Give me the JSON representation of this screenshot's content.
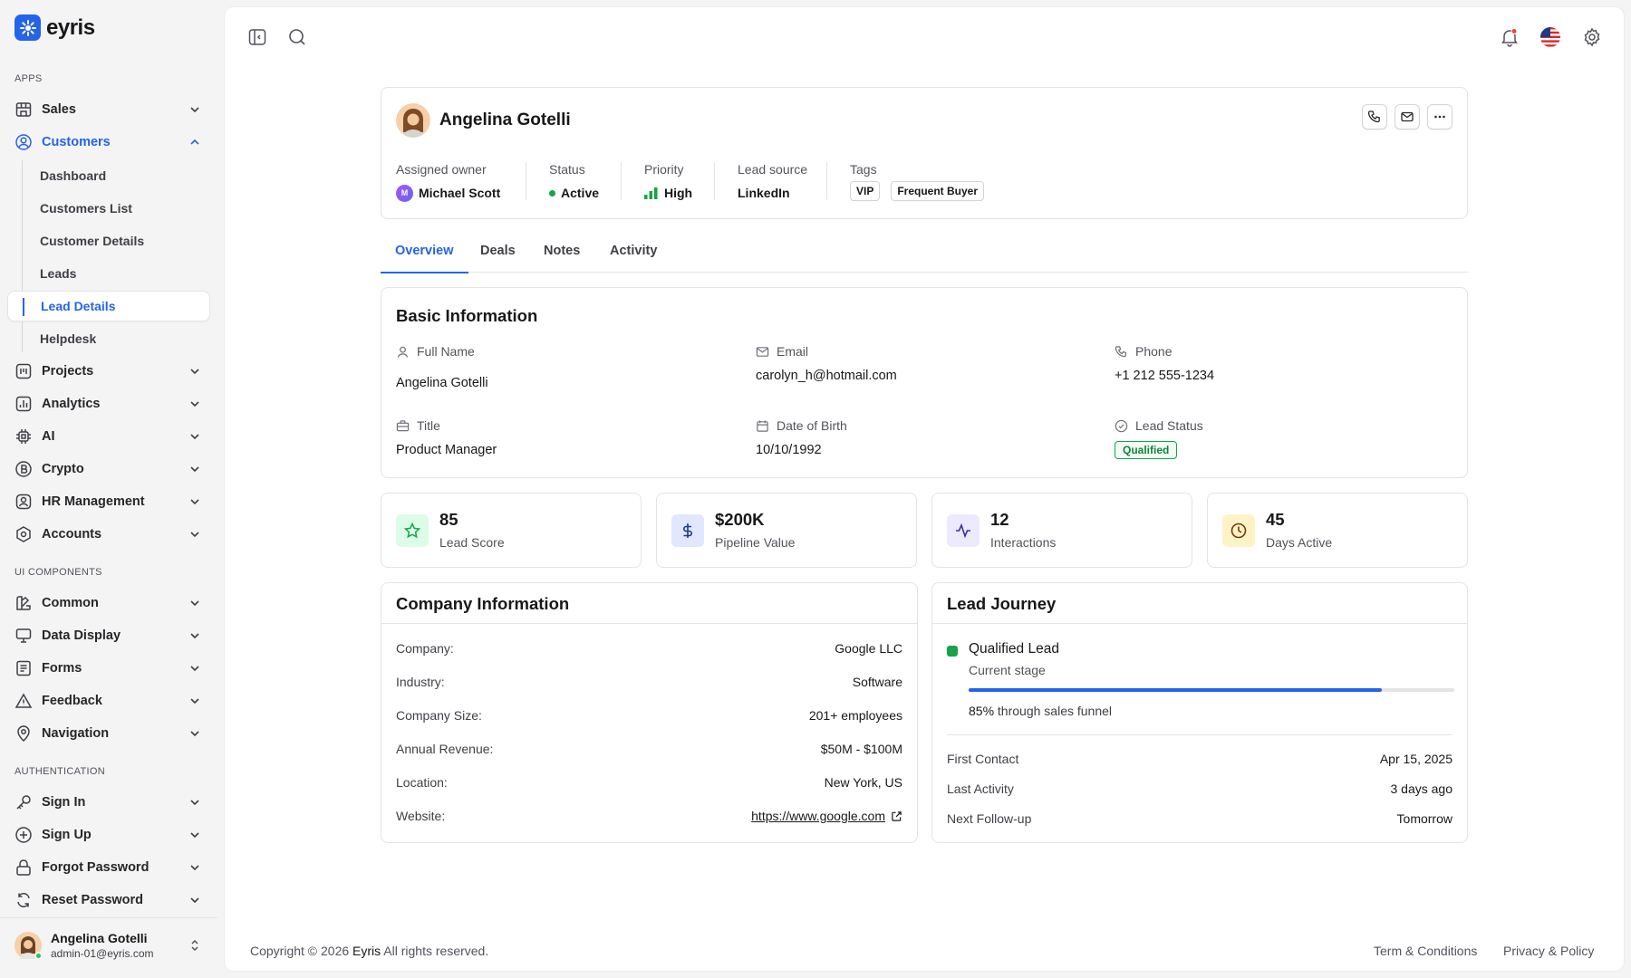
{
  "app": {
    "name": "eyris"
  },
  "sidebar": {
    "sections": {
      "apps": "APPS",
      "ui": "UI COMPONENTS",
      "auth": "AUTHENTICATION"
    },
    "apps": [
      {
        "label": "Sales"
      },
      {
        "label": "Customers"
      }
    ],
    "customers_sub": [
      "Dashboard",
      "Customers List",
      "Customer Details",
      "Leads",
      "Lead Details",
      "Helpdesk"
    ],
    "apps2": [
      {
        "label": "Projects"
      },
      {
        "label": "Analytics"
      },
      {
        "label": "AI"
      },
      {
        "label": "Crypto"
      },
      {
        "label": "HR Management"
      },
      {
        "label": "Accounts"
      }
    ],
    "ui": [
      {
        "label": "Common"
      },
      {
        "label": "Data Display"
      },
      {
        "label": "Forms"
      },
      {
        "label": "Feedback"
      },
      {
        "label": "Navigation"
      }
    ],
    "auth": [
      {
        "label": "Sign In"
      },
      {
        "label": "Sign Up"
      },
      {
        "label": "Forgot Password"
      },
      {
        "label": "Reset Password"
      }
    ],
    "user": {
      "name": "Angelina Gotelli",
      "email": "admin-01@eyris.com"
    }
  },
  "profile": {
    "name": "Angelina Gotelli",
    "meta": {
      "owner_label": "Assigned owner",
      "owner": "Michael Scott",
      "owner_initial": "M",
      "status_label": "Status",
      "status": "Active",
      "priority_label": "Priority",
      "priority": "High",
      "source_label": "Lead source",
      "source": "LinkedIn",
      "tags_label": "Tags",
      "tags": [
        "VIP",
        "Frequent Buyer"
      ]
    }
  },
  "tabs": [
    "Overview",
    "Deals",
    "Notes",
    "Activity"
  ],
  "basic": {
    "title": "Basic Information",
    "full_name_label": "Full Name",
    "full_name": "Angelina Gotelli",
    "email_label": "Email",
    "email": "carolyn_h@hotmail.com",
    "phone_label": "Phone",
    "phone": "+1 212 555-1234",
    "title_label": "Title",
    "job_title": "Product Manager",
    "dob_label": "Date of Birth",
    "dob": "10/10/1992",
    "lead_status_label": "Lead Status",
    "lead_status": "Qualified"
  },
  "stats": [
    {
      "value": "85",
      "label": "Lead Score",
      "icon": "star-icon",
      "color": "#16a34a",
      "bg": "#dcfce7"
    },
    {
      "value": "$200K",
      "label": "Pipeline Value",
      "icon": "dollar-icon",
      "color": "#1e3a8a",
      "bg": "#e0e7ff"
    },
    {
      "value": "12",
      "label": "Interactions",
      "icon": "activity-icon",
      "color": "#3730a3",
      "bg": "#ede9fe"
    },
    {
      "value": "45",
      "label": "Days Active",
      "icon": "clock-icon",
      "color": "#78350f",
      "bg": "#fef3c7"
    }
  ],
  "company": {
    "title": "Company Information",
    "rows": [
      {
        "k": "Company:",
        "v": "Google LLC"
      },
      {
        "k": "Industry:",
        "v": "Software"
      },
      {
        "k": "Company Size:",
        "v": "201+ employees"
      },
      {
        "k": "Annual Revenue:",
        "v": "$50M - $100M"
      },
      {
        "k": "Location:",
        "v": "New York, US"
      },
      {
        "k": "Website:",
        "v": "https://www.google.com"
      }
    ]
  },
  "journey": {
    "title": "Lead Journey",
    "stage": "Qualified Lead",
    "stage_sub": "Current stage",
    "progress": 85,
    "progress_pct": "85%",
    "progress_text": "through sales funnel",
    "rows": [
      {
        "k": "First Contact",
        "v": "Apr 15, 2025"
      },
      {
        "k": "Last Activity",
        "v": "3 days ago"
      },
      {
        "k": "Next Follow-up",
        "v": "Tomorrow"
      }
    ]
  },
  "footer": {
    "copyright_pre": "Copyright © 2026",
    "brand": "Eyris",
    "copyright_post": "All rights reserved.",
    "terms": "Term & Conditions",
    "privacy": "Privacy & Policy"
  }
}
